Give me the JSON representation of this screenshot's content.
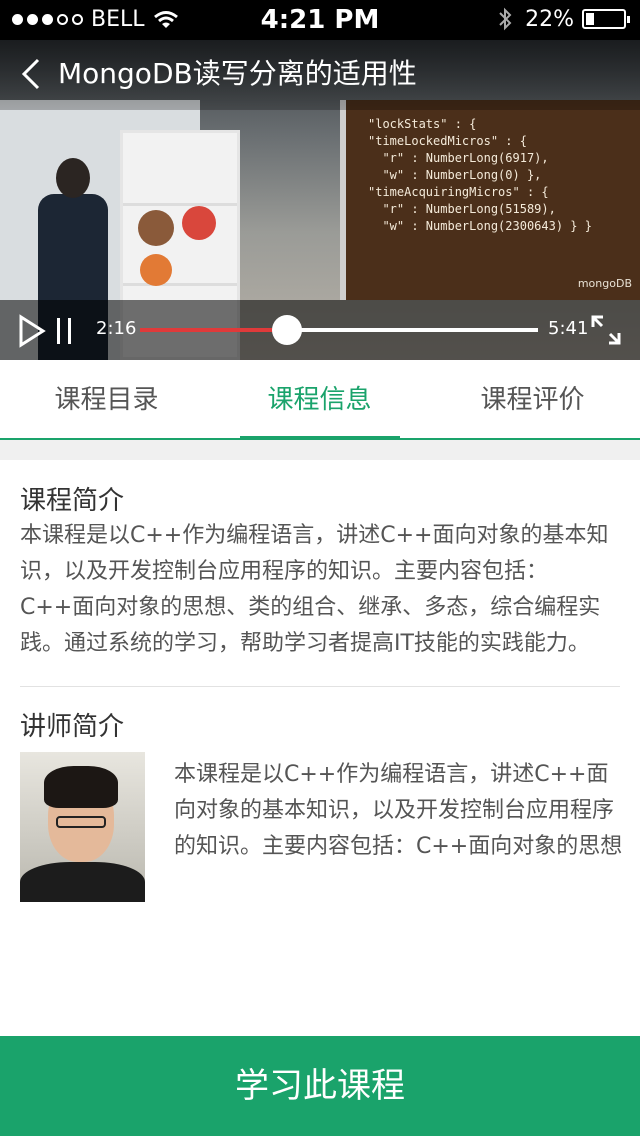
{
  "status_bar": {
    "carrier": "BELL",
    "time": "4:21 PM",
    "battery": "22%",
    "battery_level": 0.22
  },
  "video": {
    "title": "MongoDB读写分离的适用性",
    "current_time": "2:16",
    "duration": "5:41",
    "progress": 0.37,
    "slide_code": "\"lockStats\" : {\n\"timeLockedMicros\" : {\n  \"r\" : NumberLong(6917),\n  \"w\" : NumberLong(0) },\n\"timeAcquiringMicros\" : {\n  \"r\" : NumberLong(51589),\n  \"w\" : NumberLong(2300643) } }",
    "slide_logo": "mongoDB"
  },
  "tabs": [
    {
      "label": "课程目录"
    },
    {
      "label": "课程信息",
      "active": true
    },
    {
      "label": "课程评价"
    }
  ],
  "course_intro": {
    "heading": "课程简介",
    "text": " 本课程是以C++作为编程语言，讲述C++面向对象的基本知识，以及开发控制台应用程序的知识。主要内容包括：C++面向对象的思想、类的组合、继承、多态，综合编程实践。通过系统的学习，帮助学习者提高IT技能的实践能力。"
  },
  "teacher_intro": {
    "heading": "讲师简介",
    "text": "本课程是以C++作为编程语言，讲述C++面向对象的基本知识，以及开发控制台应用程序的知识。主要内容包括：C++面向对象的思想"
  },
  "action_button": {
    "label": "学习此课程"
  },
  "colors": {
    "accent": "#1aa36b",
    "progress": "#e03a3a"
  }
}
